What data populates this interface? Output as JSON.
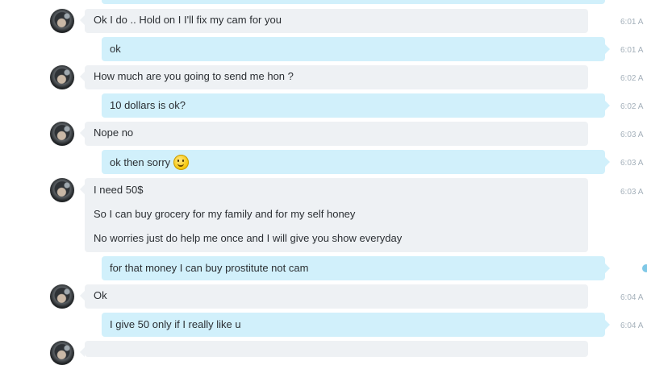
{
  "messages": [
    {
      "id": "m1",
      "direction": "in",
      "text": "Ok I do .. Hold on I I'll fix my cam for you",
      "time": "6:01 A"
    },
    {
      "id": "m2",
      "direction": "out",
      "text": "ok",
      "time": "6:01 A"
    },
    {
      "id": "m3",
      "direction": "in",
      "text": "How much are you going to send me hon ?",
      "time": "6:02 A"
    },
    {
      "id": "m4",
      "direction": "out",
      "text": "10 dollars is ok?",
      "time": "6:02 A"
    },
    {
      "id": "m5",
      "direction": "in",
      "text": "Nope no",
      "time": "6:03 A"
    },
    {
      "id": "m6",
      "direction": "out",
      "text": "ok then sorry",
      "emoji": "smiley-emoji",
      "time": "6:03 A"
    },
    {
      "id": "m7",
      "direction": "in",
      "lines": [
        "I need 50$",
        "So I can buy grocery for my family and for my self honey",
        "No worries just do help me once and I will give you show everyday"
      ],
      "time": "6:03 A"
    },
    {
      "id": "m8",
      "direction": "out",
      "text": "for that money I can buy prostitute not cam",
      "status": "sending"
    },
    {
      "id": "m9",
      "direction": "in",
      "text": "Ok",
      "time": "6:04 A"
    },
    {
      "id": "m10",
      "direction": "out",
      "text": "I give 50 only if I really like u",
      "time": "6:04 A"
    }
  ],
  "colors": {
    "incoming_bubble": "#eef1f4",
    "outgoing_bubble": "#d1f0fb",
    "timestamp": "#a4b0ba",
    "pending_indicator": "#7fc8e6"
  },
  "icons": {
    "avatar": "contact-avatar",
    "emoji": "smiley-emoji",
    "pending": "sending-dot-icon"
  }
}
